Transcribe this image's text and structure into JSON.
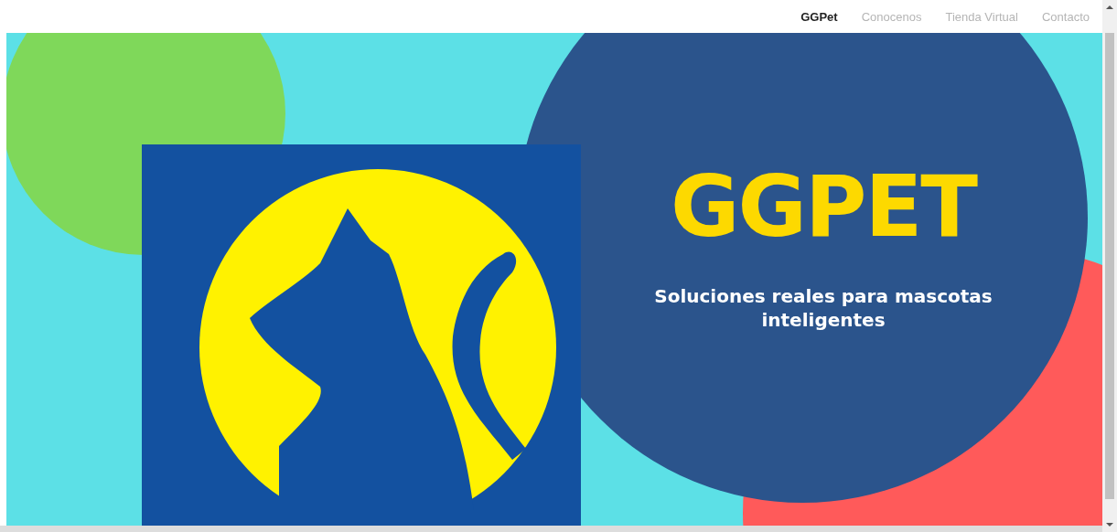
{
  "nav": {
    "items": [
      {
        "label": "GGPet",
        "selected": true
      },
      {
        "label": "Conocenos",
        "selected": false
      },
      {
        "label": "Tienda Virtual",
        "selected": false
      },
      {
        "label": "Contacto",
        "selected": false
      }
    ]
  },
  "hero": {
    "title": "GGPET",
    "subtitle": "Soluciones reales para mascotas inteligentes"
  }
}
